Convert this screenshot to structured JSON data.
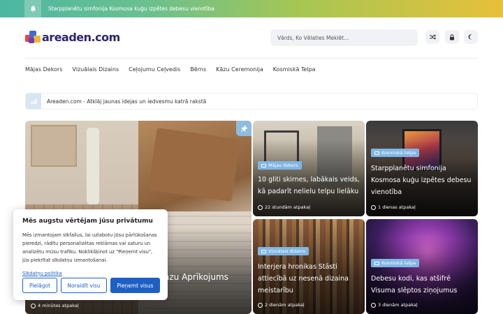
{
  "topbar": {
    "ticker": "Starpplanētu simfonija Kosmosa kuģu izpētes debesu vienotība"
  },
  "header": {
    "logo_text": "areaden.com",
    "search_placeholder": "Vārds, Ko Vēlaties Meklēt...",
    "icons": [
      "shuffle-icon",
      "lock-icon",
      "moon-icon"
    ]
  },
  "nav": {
    "items": [
      "Mājas Dekors",
      "Vizuālais Dizains",
      "Ceļojumu Ceļvedis",
      "Bērns",
      "Kāzu Ceremonija",
      "Kosmiskā Telpa"
    ]
  },
  "info": {
    "text": "Areaden.com - Atklāj jaunas idejas un iedvesmu katrā rakstā"
  },
  "cards": {
    "big": {
      "title_visible": "āzu Aprīkojums",
      "time": "4 minūtes atpakaļ"
    },
    "c1": {
      "category": "Mājas dekors",
      "title": "10 gliti skirnes, labākais veids, kā padarīt nelielu telpu lielāku",
      "time": "22 stundām atpakaļ"
    },
    "c2": {
      "category": "Kosmiskā telpa",
      "title": "Starpplanētu simfonija Kosmosa kuģu izpētes debesu vienotība",
      "time": "1 dienas atpakaļ"
    },
    "c3": {
      "category": "Vizuālais dizains",
      "title": "Interjera hronikas Stāsti attiecībā uz nesenā dizaina meistarību",
      "time": "2 dienām atpakaļ"
    },
    "c4": {
      "category": "Kosmiskā telpa",
      "title": "Debesu kodi, kas atšifrē Visuma slēptos ziņojumus",
      "time": "3 dienām atpakaļ"
    }
  },
  "cookie": {
    "title": "Mēs augstu vērtējam jūsu privātumu",
    "body": "Mēs izmantojam sīkfailus, lai uzlabotu jūsu pārlūkošanas pieredzi, rādītu personalizētas reklāmas vai saturu un analizētu mūsu trafiku. Noklikšķinot uz \"Pieņemt visu\", jūs piekrītat sīkdatņu izmantošanai.",
    "policy_link": "Sīkdatņu politika",
    "btn_customize": "Pielāgot",
    "btn_reject": "Noraidīt visu",
    "btn_accept": "Pieņemt visus"
  },
  "colors": {
    "accent_blue": "#1f5fc4",
    "category_badge": "#7fb6e4",
    "logo": "#2d2570"
  }
}
